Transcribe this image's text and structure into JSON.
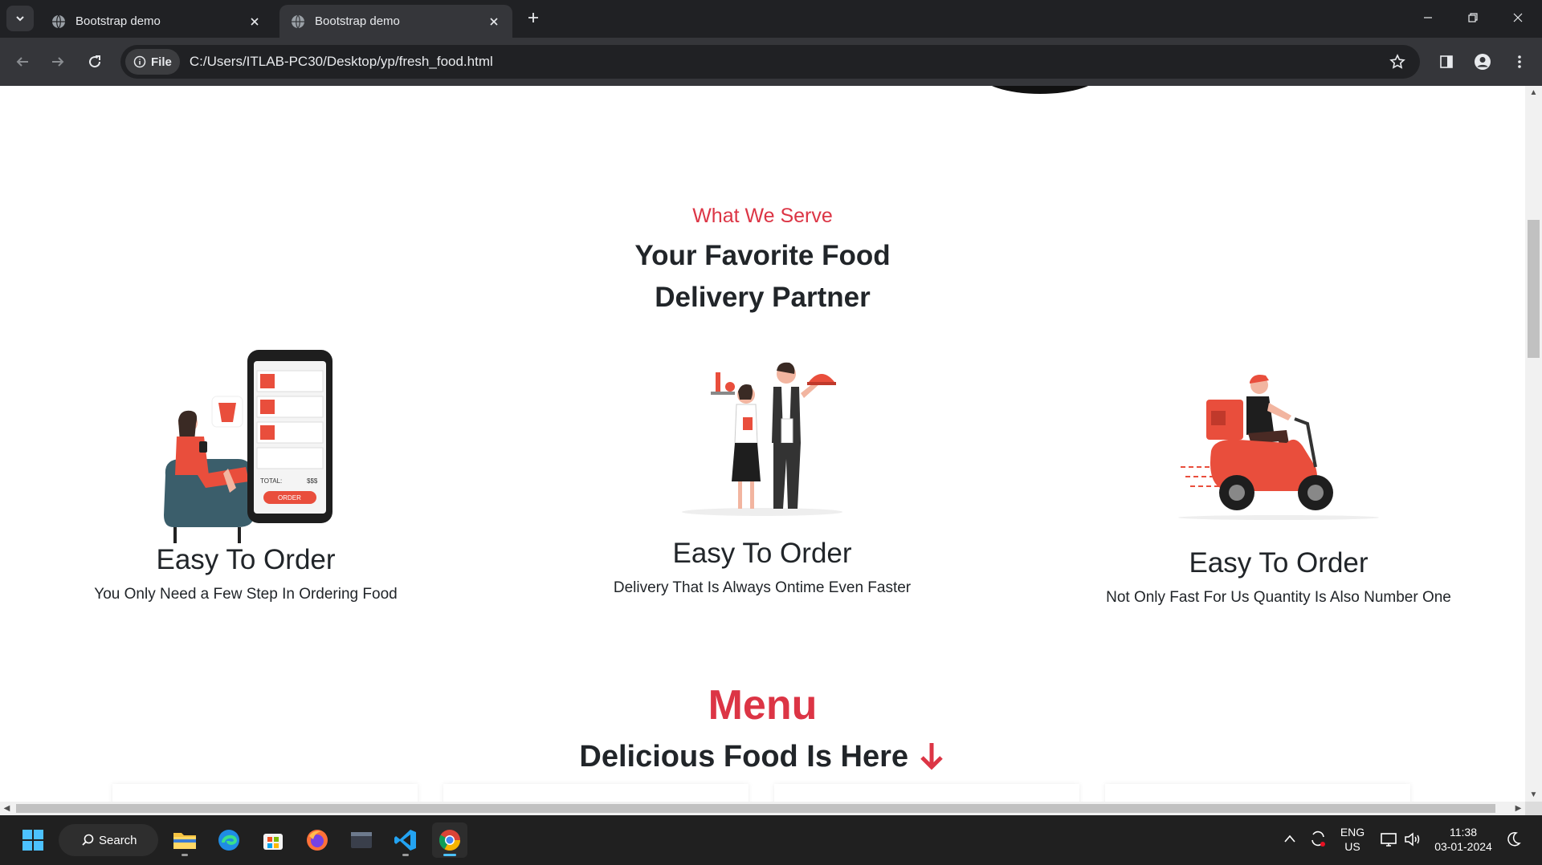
{
  "browser": {
    "tabs": [
      {
        "title": "Bootstrap demo",
        "active": false
      },
      {
        "title": "Bootstrap demo",
        "active": true
      }
    ],
    "chip_label": "File",
    "url": "C:/Users/ITLAB-PC30/Desktop/yp/fresh_food.html"
  },
  "page": {
    "section_sub": "What We Serve",
    "section_title_line1": "Your Favorite Food",
    "section_title_line2": "Delivery Partner",
    "cards": [
      {
        "title": "Easy To Order",
        "text": "You Only Need a Few Step In Ordering Food",
        "icon": "order-on-phone-illustration"
      },
      {
        "title": "Easy To Order",
        "text": "Delivery That Is Always Ontime Even Faster",
        "icon": "waiters-illustration"
      },
      {
        "title": "Easy To Order",
        "text": "Not Only Fast For Us Quantity Is Also Number One",
        "icon": "scooter-delivery-illustration"
      }
    ],
    "phone_total_label": "TOTAL:",
    "phone_total_value": "$$$",
    "phone_button": "ORDER",
    "menu_title": "Menu",
    "menu_subtitle": "Delicious Food Is Here",
    "menu_arrow": "🡣"
  },
  "taskbar": {
    "search_label": "Search",
    "lang_line1": "ENG",
    "lang_line2": "US",
    "time": "11:38",
    "date": "03-01-2024"
  },
  "colors": {
    "accent_red": "#dc3545",
    "text_dark": "#212529",
    "chrome_dark": "#202124",
    "chrome_mid": "#35363a"
  }
}
